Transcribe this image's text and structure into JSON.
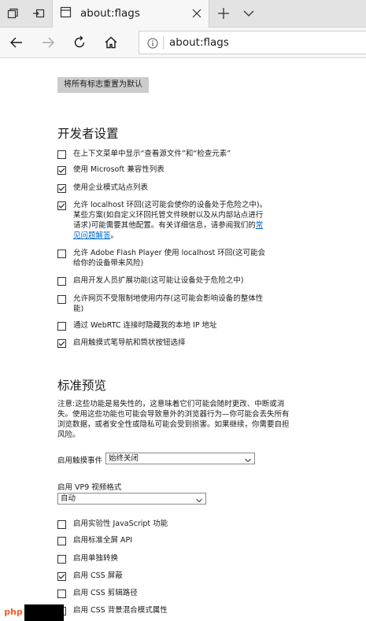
{
  "browser": {
    "tab_title": "about:flags",
    "url": "about:flags"
  },
  "page": {
    "reset_button": "将所有标志重置为默认",
    "dev_section_title": "开发者设置",
    "dev_flags": [
      {
        "label": "在上下文菜单中显示“查看源文件”和“检查元素”",
        "checked": false
      },
      {
        "label": "使用 Microsoft 兼容性列表",
        "checked": true
      },
      {
        "label": "使用企业模式站点列表",
        "checked": true
      },
      {
        "label_parts": [
          "允许 localhost 环回(这可能会使你的设备处于危险之中)。某些方案(如自定义环回托管文件映射以及从内部站点进行请求)可能需要其他配置。有关详细信息，请参阅我们的",
          "常见问题解答",
          "。"
        ],
        "checked": true
      },
      {
        "label": "允许 Adobe Flash Player 使用 localhost 环回(这可能会给你的设备带来风险)",
        "checked": false
      },
      {
        "label": "启用开发人员扩展功能(这可能让设备处于危险之中)",
        "checked": false
      },
      {
        "label": "允许网页不受限制地使用内存(这可能会影响设备的整体性能)",
        "checked": false
      },
      {
        "label": "通过 WebRTC 连接时隐藏我的本地 IP 地址",
        "checked": false
      },
      {
        "label": "启用触摸式笔导航和筒状按钮选择",
        "checked": true
      }
    ],
    "std_section_title": "标准预览",
    "note": "注意:这些功能是易失性的，这意味着它们可能会随时更改、中断或消失。使用这些功能也可能会导致意外的浏览器行为—你可能会丢失所有浏览数据，或者安全性或隐私可能会受到损害。如果继续，你需要自担风险。",
    "touch_events": {
      "label": "启用触摸事件",
      "value": "始终关闭"
    },
    "vp9": {
      "label": "启用 VP9 视频格式",
      "value": "自动"
    },
    "std_flags": [
      {
        "label": "启用实验性 JavaScript 功能",
        "checked": false
      },
      {
        "label": "启用标准全屏 API",
        "checked": false
      },
      {
        "label": "启用单独转换",
        "checked": false
      },
      {
        "label": "启用 CSS 屏蔽",
        "checked": true
      },
      {
        "label": "启用 CSS 剪辑路径",
        "checked": false
      },
      {
        "label": "启用 CSS 背景混合模式属性",
        "checked": false
      }
    ],
    "watermark": "php"
  },
  "colors": {
    "link": "#0066cc",
    "tab_strip": "#e3e3e3",
    "button_bg": "#cccccc"
  }
}
